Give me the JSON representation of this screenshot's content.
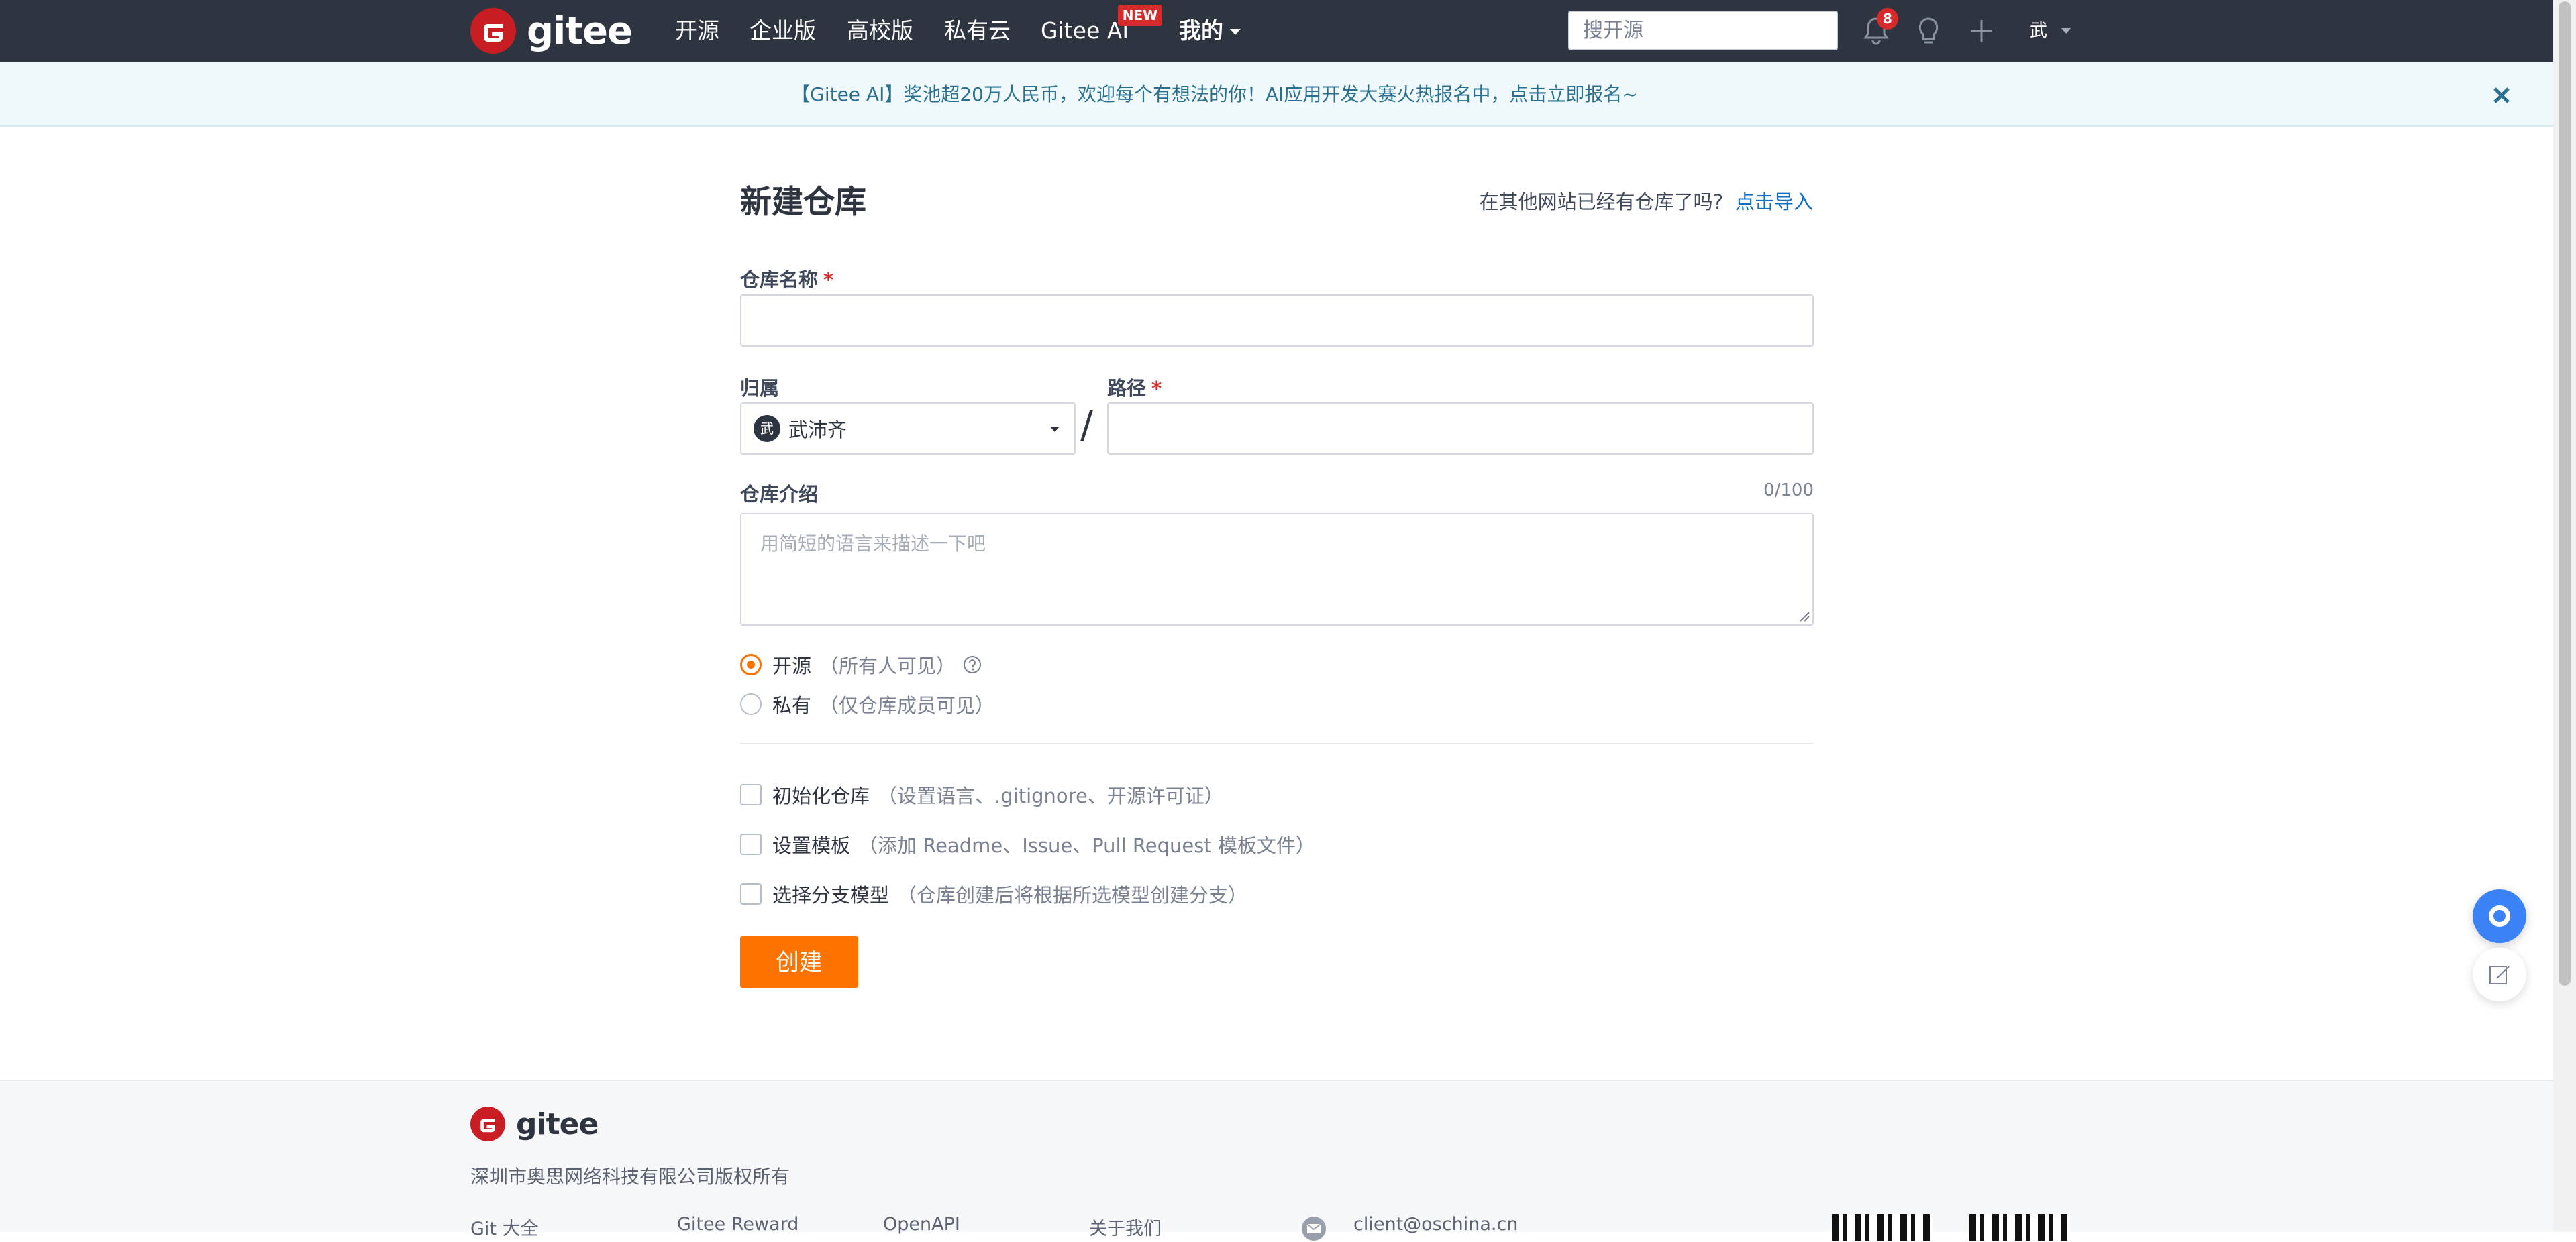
{
  "colors": {
    "nav_bg": "#2e3440",
    "accent": "#fe7300",
    "link": "#0e6ec9",
    "required": "#d72b2b",
    "banner_bg": "#eff9fb"
  },
  "nav": {
    "logo_text": "gitee",
    "items": [
      "开源",
      "企业版",
      "高校版",
      "私有云",
      "Gitee AI",
      "我的"
    ],
    "new_badge": "NEW",
    "search_placeholder": "搜开源",
    "notification_count": "8",
    "user_initial": "武"
  },
  "banner": {
    "text": "【Gitee AI】奖池超20万人民币，欢迎每个有想法的你！AI应用开发大赛火热报名中，点击立即报名~"
  },
  "form": {
    "title": "新建仓库",
    "import_hint": "在其他网站已经有仓库了吗?",
    "import_link": "点击导入",
    "repo_name_label": "仓库名称",
    "repo_name_value": "",
    "required_mark": "*",
    "owner_label": "归属",
    "owner_initial": "武",
    "owner_name": "武沛齐",
    "separator": "/",
    "path_label": "路径",
    "path_value": "",
    "desc_label": "仓库介绍",
    "desc_counter": "0/100",
    "desc_placeholder": "用简短的语言来描述一下吧",
    "visibility": [
      {
        "label": "开源",
        "hint": "（所有人可见）",
        "selected": true
      },
      {
        "label": "私有",
        "hint": "（仅仓库成员可见）",
        "selected": false
      }
    ],
    "options": [
      {
        "label": "初始化仓库",
        "hint": "（设置语言、.gitignore、开源许可证）",
        "checked": false
      },
      {
        "label": "设置模板",
        "hint": "（添加 Readme、Issue、Pull Request 模板文件）",
        "checked": false
      },
      {
        "label": "选择分支模型",
        "hint": "（仓库创建后将根据所选模型创建分支）",
        "checked": false
      }
    ],
    "submit_label": "创建"
  },
  "footer": {
    "logo_text": "gitee",
    "copyright": "深圳市奥思网络科技有限公司版权所有",
    "links": [
      "Git 大全",
      "Gitee Reward",
      "OpenAPI",
      "关于我们"
    ],
    "email": "client@oschina.cn"
  }
}
